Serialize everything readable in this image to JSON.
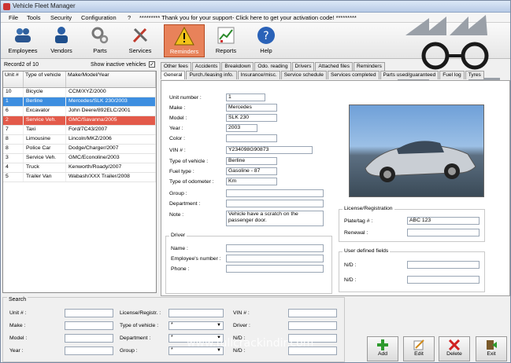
{
  "window": {
    "title": "Vehicle Fleet Manager"
  },
  "menu": {
    "items": [
      "File",
      "Tools",
      "Security",
      "Configuration",
      "?"
    ],
    "promo": "********* Thank you for your support- Click here to get your activation code! *********"
  },
  "toolbar": [
    {
      "label": "Employees",
      "icon": "employees-icon"
    },
    {
      "label": "Vendors",
      "icon": "vendors-icon"
    },
    {
      "label": "Parts",
      "icon": "parts-icon"
    },
    {
      "label": "Services",
      "icon": "services-icon"
    },
    {
      "label": "Reminders",
      "icon": "warning-icon"
    },
    {
      "label": "Reports",
      "icon": "reports-icon"
    },
    {
      "label": "Help",
      "icon": "help-icon"
    }
  ],
  "left": {
    "record": "Record2 of 10",
    "show_inactive": "Show inactive vehicles",
    "columns": [
      "Unit #",
      "Type of vehicle",
      "Make/Model/Year"
    ],
    "rows": [
      [
        "10",
        "Bicycle",
        "CCM/XYZ/2000"
      ],
      [
        "1",
        "Berline",
        "Mercedes/SLK 230/2003"
      ],
      [
        "6",
        "Excavator",
        "John Deere/892ELC/2001"
      ],
      [
        "2",
        "Service Veh.",
        "GMC/Savanna/2005"
      ],
      [
        "7",
        "Taxi",
        "Ford/7C43/2007"
      ],
      [
        "8",
        "Limousine",
        "Lincoln/MKZ/2006"
      ],
      [
        "8",
        "Police Car",
        "Dodge/Charger/2007"
      ],
      [
        "3",
        "Service Veh.",
        "GMC/Econoline/2003"
      ],
      [
        "4",
        "Truck",
        "Kenworth/Roady/2007"
      ],
      [
        "5",
        "Trailer Van",
        "Wabash/XXX Trailer/2008"
      ]
    ]
  },
  "tabs": {
    "row1": [
      "Other fees",
      "Accidents",
      "Breakdown",
      "Odo. reading",
      "Drivers",
      "Attached files",
      "Reminders"
    ],
    "row2": [
      "General",
      "Purch./leasing info.",
      "Insurance/misc.",
      "Service schedule",
      "Services completed",
      "Parts used/guaranteed",
      "Fuel log",
      "Tyres"
    ]
  },
  "general": {
    "unit_number": {
      "label": "Unit number :",
      "value": "1"
    },
    "make": {
      "label": "Make :",
      "value": "Mercedes"
    },
    "model": {
      "label": "Model :",
      "value": "SLK 230"
    },
    "year": {
      "label": "Year :",
      "value": "2003"
    },
    "color": {
      "label": "Color :",
      "value": ""
    },
    "vin": {
      "label": "VIN # :",
      "value": "Y234098G90873"
    },
    "type": {
      "label": "Type of vehicle :",
      "value": "Berline"
    },
    "fuel": {
      "label": "Fuel type :",
      "value": "Gasoline - 87"
    },
    "odometer": {
      "label": "Type of odometer :",
      "value": "Km"
    },
    "group": {
      "label": "Group :",
      "value": ""
    },
    "department": {
      "label": "Department :",
      "value": ""
    },
    "note": {
      "label": "Note :",
      "value": "Vehicle have a scratch on the passenger door."
    },
    "driver": {
      "title": "Driver",
      "name": "Name :",
      "employee_number": "Employee's number :",
      "phone": "Phone :"
    },
    "license": {
      "title": "License/Registration",
      "plate_label": "Plate/tag # :",
      "plate_value": "ABC 123",
      "renewal_label": "Renewal :"
    },
    "user_fields": {
      "title": "User defined fields",
      "nd1": "N/D :",
      "nd2": "N/D :"
    }
  },
  "search": {
    "title": "Search",
    "unit": "Unit # :",
    "make": "Make :",
    "model": "Model :",
    "year": "Year :",
    "license": "License/Registr. :",
    "type": "Type of vehicle :",
    "department": "Department :",
    "group": "Group :",
    "vin": "VIN # :",
    "driver": "Driver :",
    "nd1": "N/D :",
    "nd2": "N/D :",
    "select_default": "*"
  },
  "actions": {
    "add": "Add",
    "edit": "Edit",
    "delete": "Delete",
    "exit": "Exit"
  },
  "watermark": "www.fullcrackindir.com",
  "colors": {
    "selected": "#3d8ee0",
    "highlight_red": "#e35a4a",
    "reminders_active": "#e8825a"
  }
}
